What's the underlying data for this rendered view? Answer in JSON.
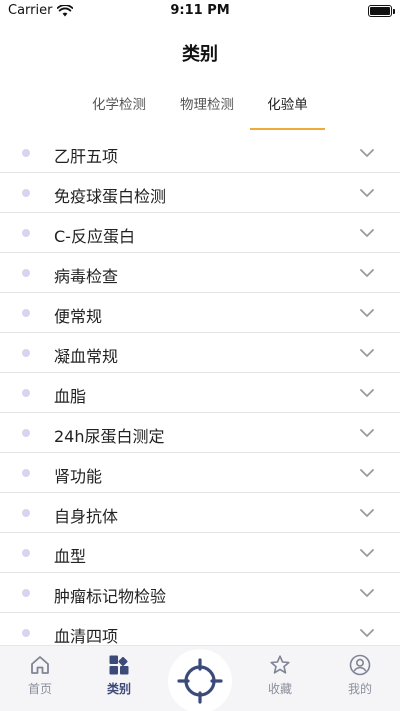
{
  "status_bar": {
    "carrier": "Carrier",
    "time": "9:11 PM"
  },
  "header": {
    "title": "类别"
  },
  "tabs": [
    {
      "label": "化学检测",
      "active": false
    },
    {
      "label": "物理检测",
      "active": false
    },
    {
      "label": "化验单",
      "active": true
    }
  ],
  "items": [
    {
      "label": "乙肝五项"
    },
    {
      "label": "免疫球蛋白检测"
    },
    {
      "label": "C-反应蛋白"
    },
    {
      "label": "病毒检查"
    },
    {
      "label": "便常规"
    },
    {
      "label": "凝血常规"
    },
    {
      "label": "血脂"
    },
    {
      "label": "24h尿蛋白测定"
    },
    {
      "label": "肾功能"
    },
    {
      "label": "自身抗体"
    },
    {
      "label": "血型"
    },
    {
      "label": "肿瘤标记物检验"
    },
    {
      "label": "血清四项"
    }
  ],
  "tabbar": {
    "home": {
      "label": "首页",
      "icon": "home-icon"
    },
    "category": {
      "label": "类别",
      "icon": "category-icon",
      "active": true
    },
    "scan": {
      "icon": "target-icon"
    },
    "favorites": {
      "label": "收藏",
      "icon": "star-icon"
    },
    "mine": {
      "label": "我的",
      "icon": "user-icon"
    }
  },
  "colors": {
    "accent": "#f0a93b",
    "tab_active": "#3b4a78",
    "tab_inactive": "#8a8f9c",
    "bullet": "#d8d3ef",
    "chevron": "#9a9a9a"
  }
}
